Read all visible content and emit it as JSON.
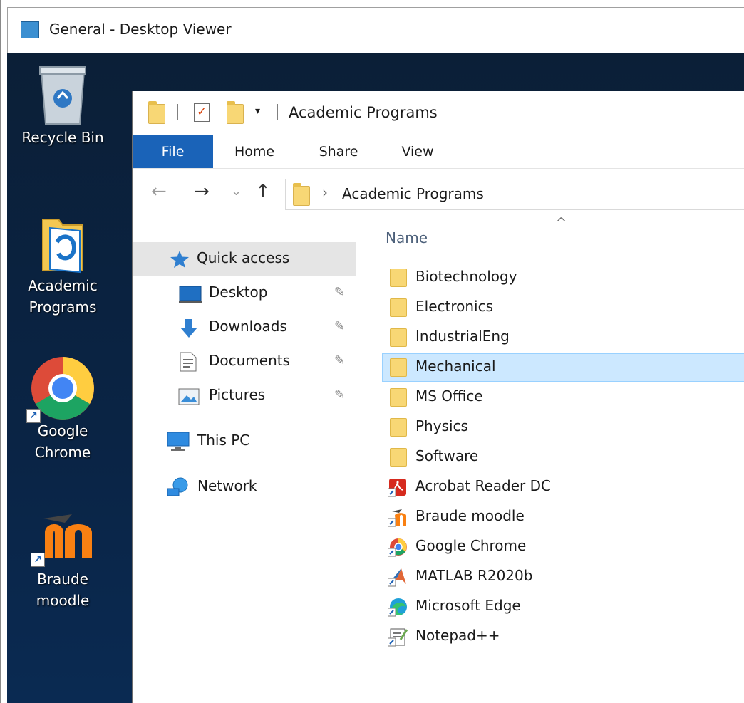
{
  "viewer": {
    "title": "General - Desktop Viewer"
  },
  "desktop": {
    "icons": [
      {
        "label": "Recycle Bin",
        "icon": "recycle-bin-icon"
      },
      {
        "label": "Academic\nPrograms",
        "icon": "folder-icon"
      },
      {
        "label": "Google\nChrome",
        "icon": "chrome-icon"
      },
      {
        "label": "Braude\nmoodle",
        "icon": "moodle-icon"
      }
    ]
  },
  "explorer": {
    "window_title": "Academic Programs",
    "qat_dropdown": "▾",
    "tabs": [
      "File",
      "Home",
      "Share",
      "View"
    ],
    "nav": {
      "back": "←",
      "forward": "→",
      "recent": "⌄",
      "up": "↑"
    },
    "address": {
      "chevron": "›",
      "path": "Academic Programs"
    },
    "nav_pane": {
      "quick_access": "Quick access",
      "items": [
        {
          "label": "Desktop",
          "pinned": true
        },
        {
          "label": "Downloads",
          "pinned": true
        },
        {
          "label": "Documents",
          "pinned": true
        },
        {
          "label": "Pictures",
          "pinned": true
        }
      ],
      "this_pc": "This PC",
      "network": "Network",
      "pin_glyph": "📌"
    },
    "content": {
      "column_header": "Name",
      "sort_caret": "^",
      "files": [
        {
          "name": "Biotechnology",
          "type": "folder"
        },
        {
          "name": "Electronics",
          "type": "folder"
        },
        {
          "name": "IndustrialEng",
          "type": "folder"
        },
        {
          "name": "Mechanical",
          "type": "folder",
          "selected": true
        },
        {
          "name": "MS Office",
          "type": "folder"
        },
        {
          "name": "Physics",
          "type": "folder"
        },
        {
          "name": "Software",
          "type": "folder"
        },
        {
          "name": "Acrobat Reader DC",
          "type": "shortcut",
          "icon": "acrobat-icon"
        },
        {
          "name": "Braude moodle",
          "type": "shortcut",
          "icon": "moodle-icon"
        },
        {
          "name": "Google Chrome",
          "type": "shortcut",
          "icon": "chrome-icon"
        },
        {
          "name": "MATLAB R2020b",
          "type": "shortcut",
          "icon": "matlab-icon"
        },
        {
          "name": "Microsoft Edge",
          "type": "shortcut",
          "icon": "edge-icon"
        },
        {
          "name": "Notepad++",
          "type": "shortcut",
          "icon": "notepad-plus-plus-icon"
        }
      ]
    }
  },
  "colors": {
    "file_tab": "#1a63b8",
    "selection": "#cce8ff",
    "desktop": "#0a2445"
  }
}
